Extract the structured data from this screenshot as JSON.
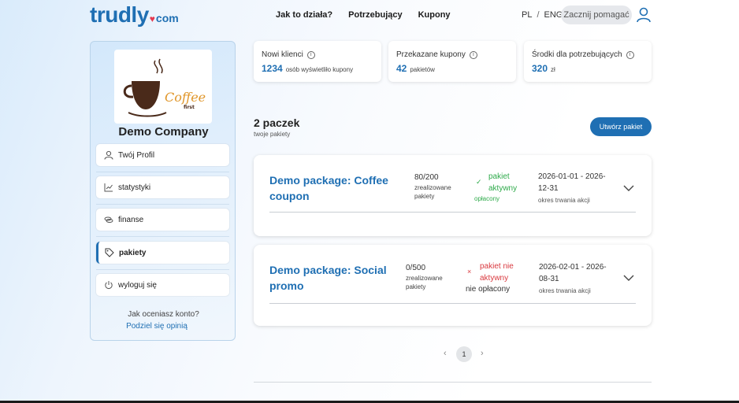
{
  "header": {
    "logo_main": "trudly",
    "logo_com": "com",
    "nav": [
      "Jak to działa?",
      "Potrzebujący",
      "Kupony"
    ],
    "lang_pl": "PL",
    "lang_sep": "/",
    "lang_eng": "ENG",
    "help_button": "Zacznij pomagać"
  },
  "sidebar": {
    "company_name": "Demo Company",
    "logo_text": "Coffee",
    "logo_subtext": "first",
    "items": [
      {
        "label": "Twój Profil",
        "icon": "user-icon"
      },
      {
        "label": "statystyki",
        "icon": "chart-icon"
      },
      {
        "label": "finanse",
        "icon": "coins-icon"
      },
      {
        "label": "pakiety",
        "icon": "tag-icon"
      },
      {
        "label": "wyloguj się",
        "icon": "power-icon"
      }
    ],
    "rating_question": "Jak oceniasz konto?",
    "rating_link": "Podziel się opinią"
  },
  "stats": [
    {
      "title": "Nowi klienci",
      "value": "1234",
      "unit": "osób wyświetliło kupony"
    },
    {
      "title": "Przekazane kupony",
      "value": "42",
      "unit": "pakietów"
    },
    {
      "title": "Środki dla potrzebujących",
      "value": "320",
      "unit": "zł"
    }
  ],
  "packages_header": {
    "count": "2 paczek",
    "subtitle": "twoje pakiety",
    "create_button": "Utwórz pakiet"
  },
  "packages": [
    {
      "name": "Demo package: Coffee coupon",
      "progress": "80/200",
      "progress_label": "zrealizowane pakiety",
      "status_mark": "✓",
      "status": "pakiet aktywny",
      "paid": "opłacony",
      "dates": "2026-01-01 - 2026-12-31",
      "dates_label": "okres trwania akcji"
    },
    {
      "name": "Demo package: Social promo",
      "progress": "0/500",
      "progress_label": "zrealizowane pakiety",
      "status_mark": "×",
      "status": "pakiet nie aktywny",
      "paid": "nie opłacony",
      "dates": "2026-02-01 - 2026-08-31",
      "dates_label": "okres trwania akcji"
    }
  ],
  "pagination": {
    "prev": "‹",
    "current": "1",
    "next": "›"
  },
  "colors": {
    "brand": "#1f6fb3",
    "heart": "#e53950",
    "active": "#2eaa4a",
    "inactive": "#d9393f"
  }
}
